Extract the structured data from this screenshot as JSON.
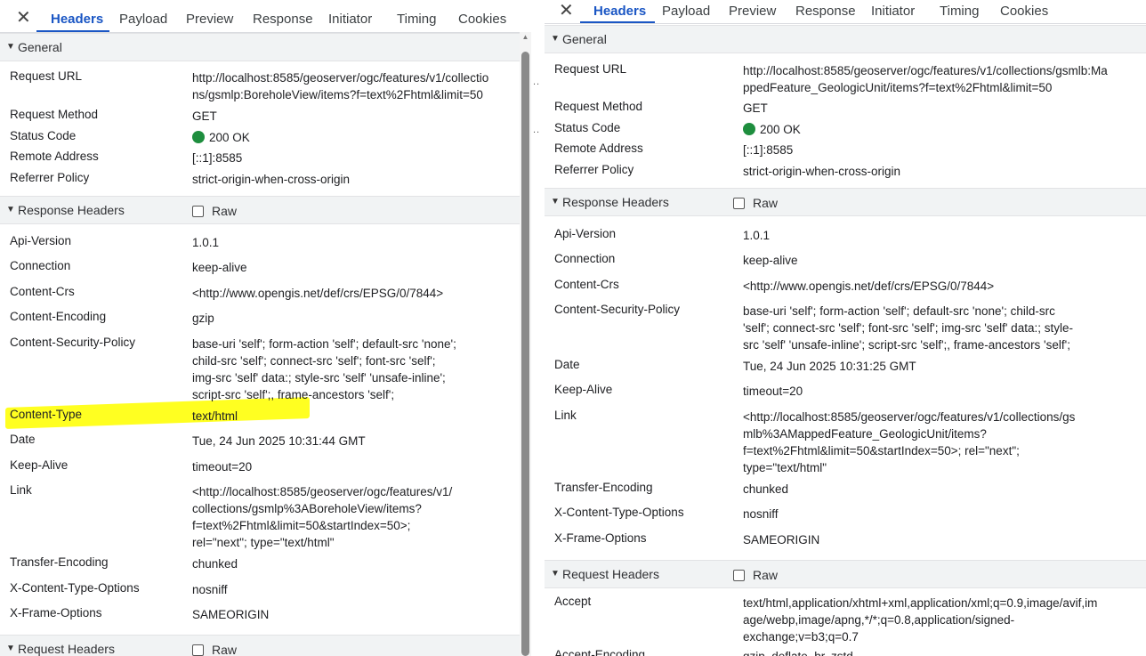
{
  "tabs": [
    "Headers",
    "Payload",
    "Preview",
    "Response",
    "Initiator",
    "Timing",
    "Cookies"
  ],
  "sections": {
    "general": "General",
    "response_headers": "Response Headers",
    "request_headers": "Request Headers",
    "raw_label": "Raw"
  },
  "left": {
    "general": [
      {
        "k": "Request URL",
        "v": "http://localhost:8585/geoserver/ogc/features/v1/collectio\nns/gsmlp:BoreholeView/items?f=text%2Fhtml&limit=50"
      },
      {
        "k": "Request Method",
        "v": "GET"
      },
      {
        "k": "Status Code",
        "v": "200 OK"
      },
      {
        "k": "Remote Address",
        "v": "[::1]:8585"
      },
      {
        "k": "Referrer Policy",
        "v": "strict-origin-when-cross-origin"
      }
    ],
    "response": [
      {
        "k": "Api-Version",
        "v": "1.0.1"
      },
      {
        "k": "Connection",
        "v": "keep-alive"
      },
      {
        "k": "Content-Crs",
        "v": "<http://www.opengis.net/def/crs/EPSG/0/7844>"
      },
      {
        "k": "Content-Encoding",
        "v": "gzip"
      },
      {
        "k": "Content-Security-Policy",
        "v": "base-uri 'self'; form-action 'self'; default-src 'none';\nchild-src 'self'; connect-src 'self'; font-src 'self';\nimg-src 'self' data:; style-src 'self' 'unsafe-inline';\nscript-src 'self';, frame-ancestors 'self';"
      },
      {
        "k": "Content-Type",
        "v": "text/html"
      },
      {
        "k": "Date",
        "v": "Tue, 24 Jun 2025 10:31:44 GMT"
      },
      {
        "k": "Keep-Alive",
        "v": "timeout=20"
      },
      {
        "k": "Link",
        "v": "<http://localhost:8585/geoserver/ogc/features/v1/\ncollections/gsmlp%3ABoreholeView/items?\nf=text%2Fhtml&limit=50&startIndex=50>;\nrel=\"next\"; type=\"text/html\""
      },
      {
        "k": "Transfer-Encoding",
        "v": "chunked"
      },
      {
        "k": "X-Content-Type-Options",
        "v": "nosniff"
      },
      {
        "k": "X-Frame-Options",
        "v": "SAMEORIGIN"
      }
    ]
  },
  "right": {
    "general": [
      {
        "k": "Request URL",
        "v": "http://localhost:8585/geoserver/ogc/features/v1/collections/gsmlb:Ma\nppedFeature_GeologicUnit/items?f=text%2Fhtml&limit=50"
      },
      {
        "k": "Request Method",
        "v": "GET"
      },
      {
        "k": "Status Code",
        "v": "200 OK"
      },
      {
        "k": "Remote Address",
        "v": "[::1]:8585"
      },
      {
        "k": "Referrer Policy",
        "v": "strict-origin-when-cross-origin"
      }
    ],
    "response": [
      {
        "k": "Api-Version",
        "v": "1.0.1"
      },
      {
        "k": "Connection",
        "v": "keep-alive"
      },
      {
        "k": "Content-Crs",
        "v": "<http://www.opengis.net/def/crs/EPSG/0/7844>"
      },
      {
        "k": "Content-Security-Policy",
        "v": "base-uri 'self'; form-action 'self'; default-src 'none'; child-src\n'self'; connect-src 'self'; font-src 'self'; img-src 'self' data:; style-\nsrc 'self' 'unsafe-inline'; script-src 'self';, frame-ancestors 'self';"
      },
      {
        "k": "Date",
        "v": "Tue, 24 Jun 2025 10:31:25 GMT"
      },
      {
        "k": "Keep-Alive",
        "v": "timeout=20"
      },
      {
        "k": "Link",
        "v": "<http://localhost:8585/geoserver/ogc/features/v1/collections/gs\nmlb%3AMappedFeature_GeologicUnit/items?\nf=text%2Fhtml&limit=50&startIndex=50>; rel=\"next\";\ntype=\"text/html\""
      },
      {
        "k": "Transfer-Encoding",
        "v": "chunked"
      },
      {
        "k": "X-Content-Type-Options",
        "v": "nosniff"
      },
      {
        "k": "X-Frame-Options",
        "v": "SAMEORIGIN"
      }
    ],
    "request": [
      {
        "k": "Accept",
        "v": "text/html,application/xhtml+xml,application/xml;q=0.9,image/avif,im\nage/webp,image/apng,*/*;q=0.8,application/signed-\nexchange;v=b3;q=0.7"
      },
      {
        "k": "Accept-Encoding",
        "v": "gzip, deflate, br, zstd"
      }
    ]
  }
}
